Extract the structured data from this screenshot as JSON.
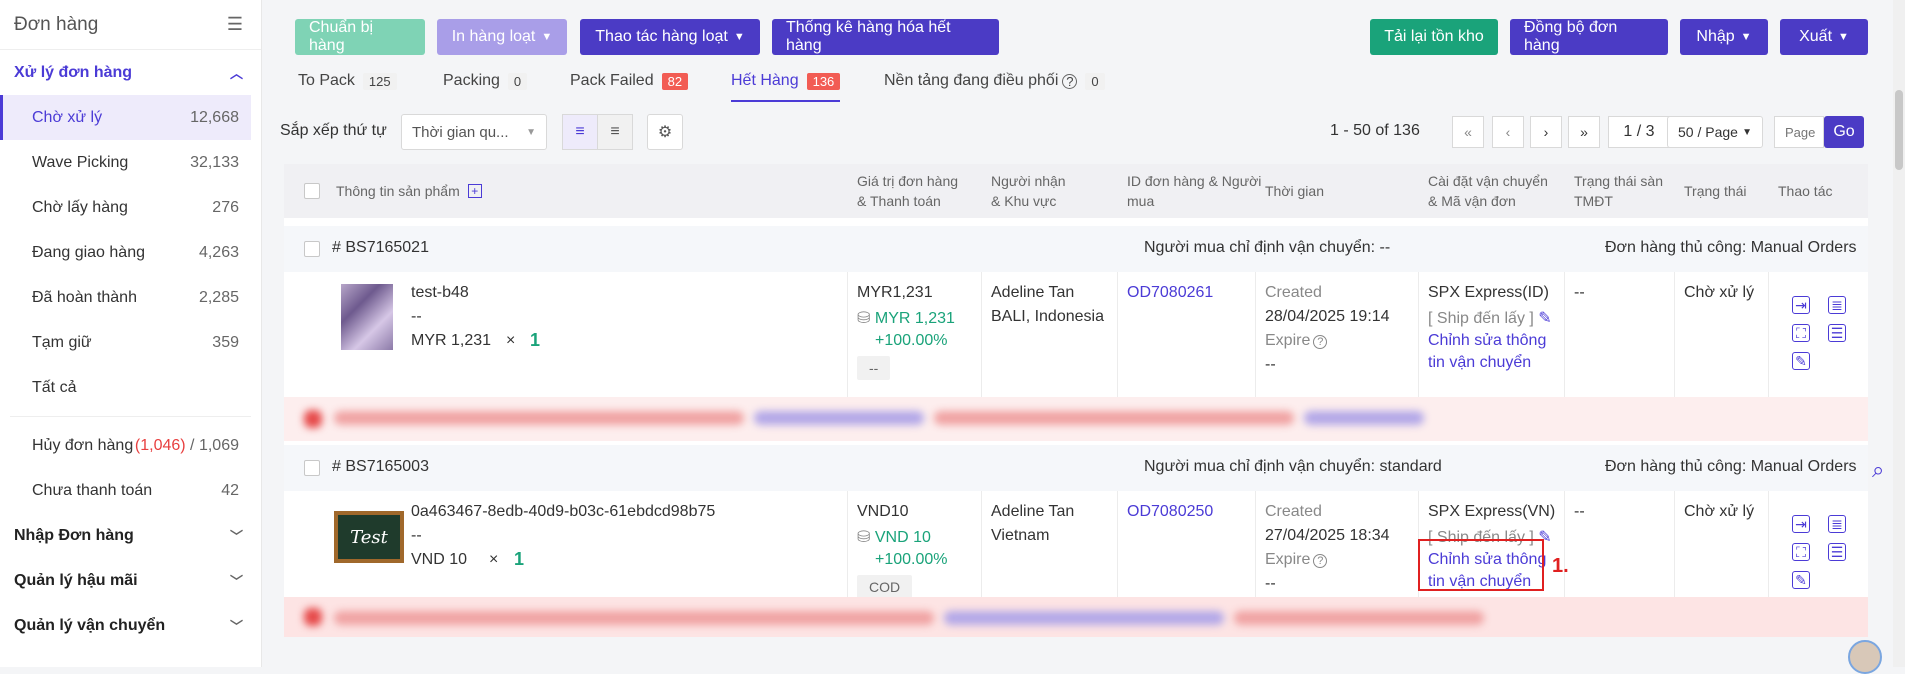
{
  "sidebar": {
    "title": "Đơn hàng",
    "collapse_icon": "menu-collapse-icon",
    "group_processing": "Xử lý đơn hàng",
    "items": [
      {
        "label": "Chờ xử lý",
        "count": "12,668"
      },
      {
        "label": "Wave Picking",
        "count": "32,133"
      },
      {
        "label": "Chờ lấy hàng",
        "count": "276"
      },
      {
        "label": "Đang giao hàng",
        "count": "4,263"
      },
      {
        "label": "Đã hoàn thành",
        "count": "2,285"
      },
      {
        "label": "Tạm giữ",
        "count": "359"
      },
      {
        "label": "Tất cả",
        "count": ""
      }
    ],
    "cancel": {
      "label": "Hủy đơn hàng",
      "red": "(1,046)",
      "sep": " / ",
      "total": "1,069"
    },
    "unpaid": {
      "label": "Chưa thanh toán",
      "count": "42"
    },
    "groups": [
      "Nhập Đơn hàng",
      "Quản lý hậu mãi",
      "Quản lý vận chuyển"
    ]
  },
  "toolbar": {
    "prepare": "Chuẩn bị hàng",
    "print_bulk": "In hàng loạt",
    "bulk_ops": "Thao tác hàng loạt",
    "stats": "Thống kê hàng hóa hết hàng",
    "reload_stock": "Tải lại tồn kho",
    "sync_orders": "Đồng bộ đơn hàng",
    "import": "Nhập",
    "export": "Xuất"
  },
  "tabs": [
    {
      "label": "To Pack",
      "badge": "125"
    },
    {
      "label": "Packing",
      "badge": "0"
    },
    {
      "label": "Pack Failed",
      "badge": "82"
    },
    {
      "label": "Hết Hàng",
      "badge": "136"
    },
    {
      "label": "Nền tảng đang điều phối",
      "badge": "0"
    }
  ],
  "sort": {
    "label": "Sắp xếp thứ tự",
    "value": "Thời gian qu..."
  },
  "pagination": {
    "range": "1 - 50 of 136",
    "page": "1 / 3",
    "per_page": "50 / Page",
    "page_placeholder": "Page",
    "go": "Go"
  },
  "table_headers": {
    "product": "Thông tin sản phẩm",
    "value1": "Giá trị đơn hàng",
    "value2": "& Thanh toán",
    "recipient1": "Người nhận",
    "recipient2": "& Khu vực",
    "id1": "ID đơn hàng & Người",
    "id2": "mua",
    "time": "Thời gian",
    "ship1": "Cài đặt vận chuyển",
    "ship2": "& Mã vận đơn",
    "ecom1": "Trạng thái sàn",
    "ecom2": "TMĐT",
    "status": "Trạng thái",
    "action": "Thao tác"
  },
  "orders": [
    {
      "number": "# BS7165021",
      "buyer_ship": "Người mua chỉ định vận chuyển: --",
      "manual": "Đơn hàng thủ công: Manual Orders",
      "product_name": "test-b48",
      "product_sub": "--",
      "product_price": "MYR 1,231",
      "times": "×",
      "qty": "1",
      "value": "MYR1,231",
      "value_green": "MYR 1,231",
      "percent": "+100.00%",
      "pay": "--",
      "recipient": "Adeline Tan",
      "region": "BALI, Indonesia",
      "order_id": "OD7080261",
      "created_label": "Created",
      "created": "28/04/2025 19:14",
      "expire_label": "Expire",
      "expire": "--",
      "carrier": "SPX Express(ID)",
      "ship_to": "[ Ship đến lấy ]",
      "edit_ship1": "Chỉnh sửa thông",
      "edit_ship2": "tin vận chuyển",
      "ecom": "--",
      "status": "Chờ xử lý"
    },
    {
      "number": "# BS7165003",
      "buyer_ship": "Người mua chỉ định vận chuyển: standard",
      "manual": "Đơn hàng thủ công: Manual Orders",
      "product_name": "0a463467-8edb-40d9-b03c-61ebdcd98b75",
      "product_sub": "--",
      "product_price": "VND 10",
      "times": "×",
      "qty": "1",
      "value": "VND10",
      "value_green": "VND 10",
      "percent": "+100.00%",
      "pay": "COD",
      "recipient": "Adeline Tan",
      "region": "Vietnam",
      "order_id": "OD7080250",
      "created_label": "Created",
      "created": "27/04/2025 18:34",
      "expire_label": "Expire",
      "expire": "--",
      "carrier": "SPX Express(VN)",
      "ship_to": "[ Ship đến lấy ]",
      "edit_ship1": "Chỉnh sửa thông",
      "edit_ship2": "tin vận chuyển",
      "ecom": "--",
      "status": "Chờ xử lý",
      "thumb_text": "Test"
    }
  ],
  "annotation": "1.",
  "colors": {
    "brand": "#4b3bd6",
    "green": "#1aa37a",
    "red": "#e02020"
  }
}
